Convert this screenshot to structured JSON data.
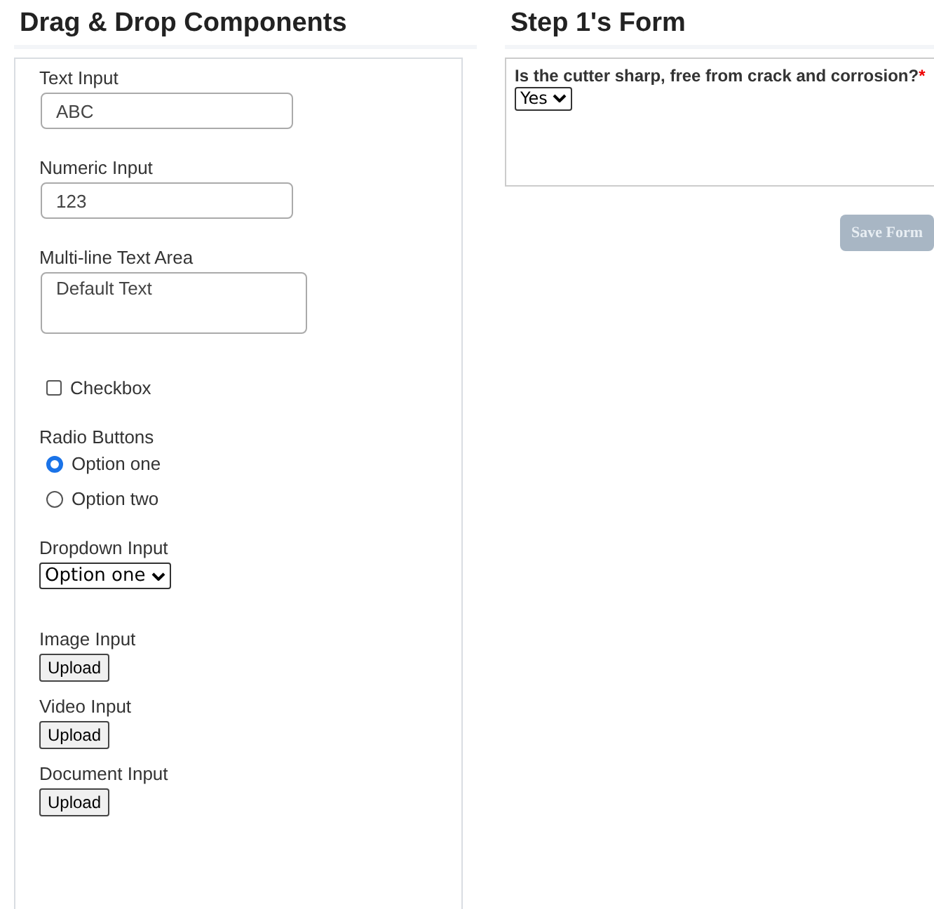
{
  "palette": {
    "title": "Drag & Drop Components",
    "components": [
      {
        "kind": "text",
        "label": "Text Input",
        "value": "ABC"
      },
      {
        "kind": "number",
        "label": "Numeric Input",
        "value": "123"
      },
      {
        "kind": "textarea",
        "label": "Multi-line Text Area",
        "value": "Default Text"
      },
      {
        "kind": "checkbox",
        "label": "Checkbox",
        "checked": false
      },
      {
        "kind": "radio",
        "label": "Radio Buttons",
        "options": [
          {
            "label": "Option one",
            "selected": true
          },
          {
            "label": "Option two",
            "selected": false
          }
        ]
      },
      {
        "kind": "dropdown",
        "label": "Dropdown Input",
        "value": "Option one"
      },
      {
        "kind": "upload",
        "label": "Image Input",
        "button": "Upload"
      },
      {
        "kind": "upload",
        "label": "Video Input",
        "button": "Upload"
      },
      {
        "kind": "upload",
        "label": "Document Input",
        "button": "Upload"
      }
    ]
  },
  "form": {
    "title": "Step 1's Form",
    "question": {
      "text": "Is the cutter sharp, free from crack and corrosion?",
      "required_mark": "*",
      "answer": "Yes"
    },
    "save_button": {
      "label": "Save Form",
      "disabled": true
    }
  }
}
